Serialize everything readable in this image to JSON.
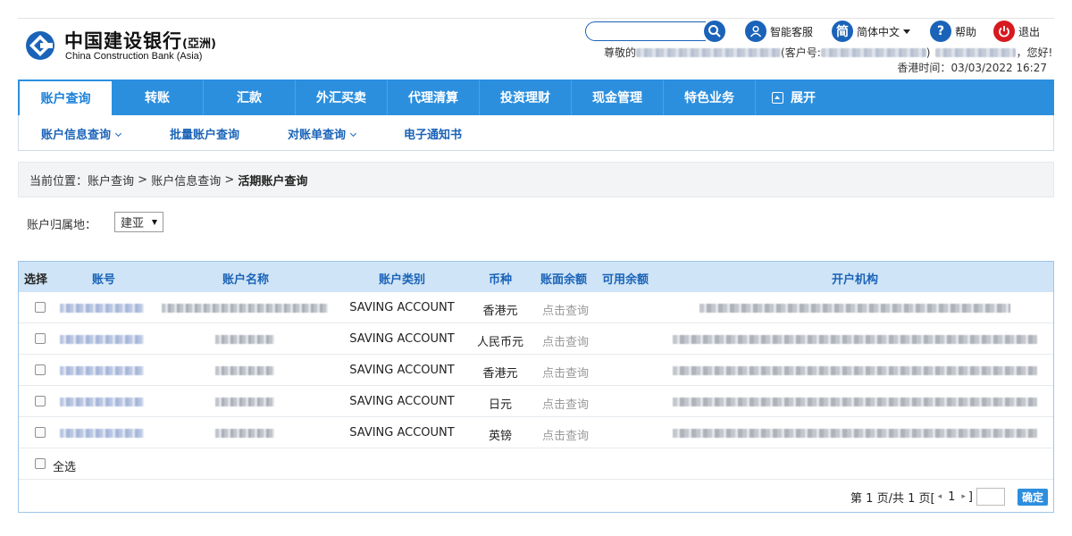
{
  "brand": {
    "name_cn": "中国建设银行",
    "name_suffix": "(亞洲)",
    "name_en": "China Construction Bank (Asia)",
    "accent_color": "#2c8fde",
    "logo_color": "#1a63b8"
  },
  "header": {
    "search_placeholder": "",
    "tools": {
      "service": "智能客服",
      "language_icon_char": "简",
      "language": "简体中文",
      "help": "帮助",
      "logout": "退出"
    },
    "greeting_prefix": "尊敬的",
    "customer_no_prefix": "(客户号:",
    "customer_no_suffix": ")",
    "greeting_suffix": "，您好!",
    "time_label": "香港时间：",
    "time_value": "03/03/2022 16:27"
  },
  "nav": {
    "items": [
      {
        "label": "账户查询",
        "active": true
      },
      {
        "label": "转账"
      },
      {
        "label": "汇款"
      },
      {
        "label": "外汇买卖"
      },
      {
        "label": "代理清算"
      },
      {
        "label": "投资理财"
      },
      {
        "label": "现金管理"
      },
      {
        "label": "特色业务"
      },
      {
        "label": "展开"
      }
    ]
  },
  "subnav": {
    "items": [
      {
        "label": "账户信息查询",
        "dropdown": true
      },
      {
        "label": "批量账户查询"
      },
      {
        "label": "对账单查询",
        "dropdown": true
      },
      {
        "label": "电子通知书"
      }
    ]
  },
  "breadcrumb": {
    "prefix": "当前位置：",
    "path": [
      "账户查询",
      "账户信息查询"
    ],
    "separator": " > ",
    "current": "活期账户查询"
  },
  "filter": {
    "label": "账户归属地：",
    "selected": "建亚"
  },
  "table": {
    "columns": [
      "选择",
      "账号",
      "账户名称",
      "账户类别",
      "币种",
      "账面余额",
      "可用余额",
      "开户机构"
    ],
    "rows": [
      {
        "account_type": "SAVING ACCOUNT",
        "currency": "香港元",
        "book_balance": "点击查询"
      },
      {
        "account_type": "SAVING ACCOUNT",
        "currency": "人民币元",
        "book_balance": "点击查询"
      },
      {
        "account_type": "SAVING ACCOUNT",
        "currency": "香港元",
        "book_balance": "点击查询"
      },
      {
        "account_type": "SAVING ACCOUNT",
        "currency": "日元",
        "book_balance": "点击查询"
      },
      {
        "account_type": "SAVING ACCOUNT",
        "currency": "英镑",
        "book_balance": "点击查询"
      }
    ],
    "select_all": "全选"
  },
  "pager": {
    "prefix": "第 1 页/共 1 页[",
    "prev": "◂",
    "page": "1",
    "next": "▸",
    "suffix": "]",
    "confirm": "确定"
  }
}
